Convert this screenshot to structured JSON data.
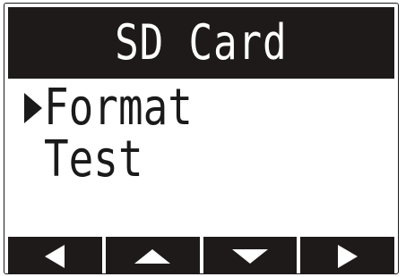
{
  "screen": {
    "title": "SD Card"
  },
  "menu": {
    "items": [
      {
        "label": "Format",
        "selected": true
      },
      {
        "label": "Test",
        "selected": false
      }
    ],
    "cursor_icon": "triangle-right-cursor-icon"
  },
  "softkeys": [
    {
      "icon": "arrow-left-icon"
    },
    {
      "icon": "arrow-up-icon"
    },
    {
      "icon": "arrow-down-icon"
    },
    {
      "icon": "arrow-right-icon"
    }
  ],
  "colors": {
    "foreground": "#1e1a19",
    "background": "#ffffff"
  }
}
